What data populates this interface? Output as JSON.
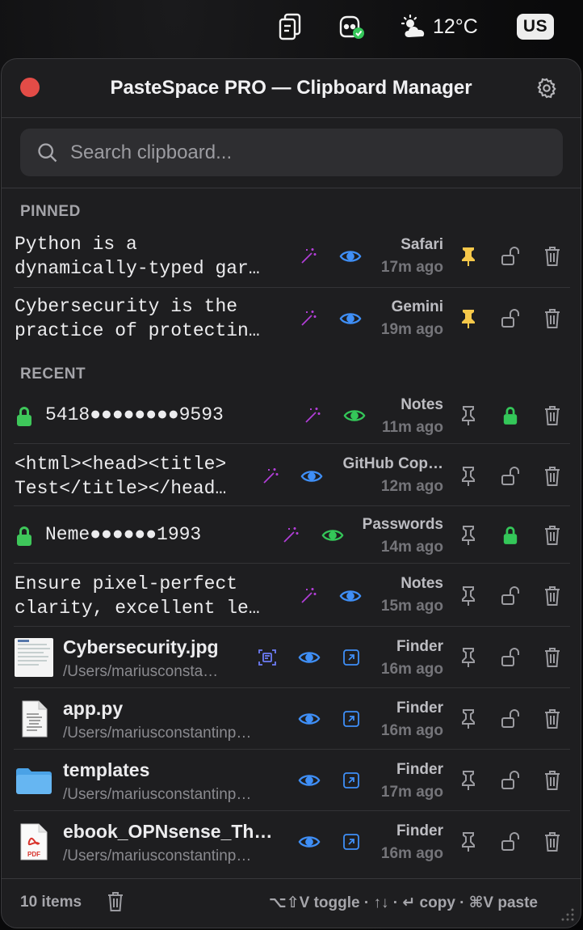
{
  "menubar": {
    "weather_temp": "12°C",
    "input_lang": "US",
    "icons": [
      "clipboard-icon",
      "copilot-icon",
      "weather-partly-sunny-icon"
    ]
  },
  "window": {
    "title": "PasteSpace PRO — Clipboard Manager"
  },
  "search": {
    "placeholder": "Search clipboard...",
    "value": ""
  },
  "sections": {
    "pinned": "PINNED",
    "recent": "RECENT"
  },
  "pinned_items": [
    {
      "line1": "Python is a",
      "line2": "dynamically-typed gar…",
      "source": "Safari",
      "time": "17m ago"
    },
    {
      "line1": "Cybersecurity is the",
      "line2": "practice of protectin…",
      "source": "Gemini",
      "time": "19m ago"
    }
  ],
  "recent_items": [
    {
      "type": "secret",
      "text": "5418●●●●●●●●9593",
      "source": "Notes",
      "time": "11m ago"
    },
    {
      "type": "text",
      "line1": "<html><head><title>",
      "line2": "Test</title></head…",
      "source": "GitHub Cop…",
      "time": "12m ago"
    },
    {
      "type": "secret",
      "text": "Neme●●●●●●1993",
      "source": "Passwords",
      "time": "14m ago"
    },
    {
      "type": "text",
      "line1": "Ensure pixel-perfect",
      "line2": "clarity, excellent le…",
      "source": "Notes",
      "time": "15m ago"
    },
    {
      "type": "file",
      "name": "Cybersecurity.jpg",
      "path": "/Users/mariusconsta…",
      "source": "Finder",
      "time": "16m ago"
    },
    {
      "type": "file",
      "name": "app.py",
      "path": "/Users/mariusconstantinp…",
      "source": "Finder",
      "time": "16m ago"
    },
    {
      "type": "file",
      "name": "templates",
      "path": "/Users/mariusconstantinp…",
      "source": "Finder",
      "time": "17m ago"
    },
    {
      "type": "file",
      "name": "ebook_OPNsense_Th…",
      "path": "/Users/mariusconstantinp…",
      "source": "Finder",
      "time": "16m ago",
      "thumb_label": "PDF"
    }
  ],
  "footer": {
    "count": "10 items",
    "hints": "⌥⇧V toggle · ↑↓ · ↵ copy · ⌘V paste"
  },
  "colors": {
    "accent_blue": "#3f8ff7",
    "pin_yellow": "#f6c84a",
    "lock_green": "#34c759",
    "wand_purple": "#b13ed6",
    "close_red": "#e34c47"
  }
}
